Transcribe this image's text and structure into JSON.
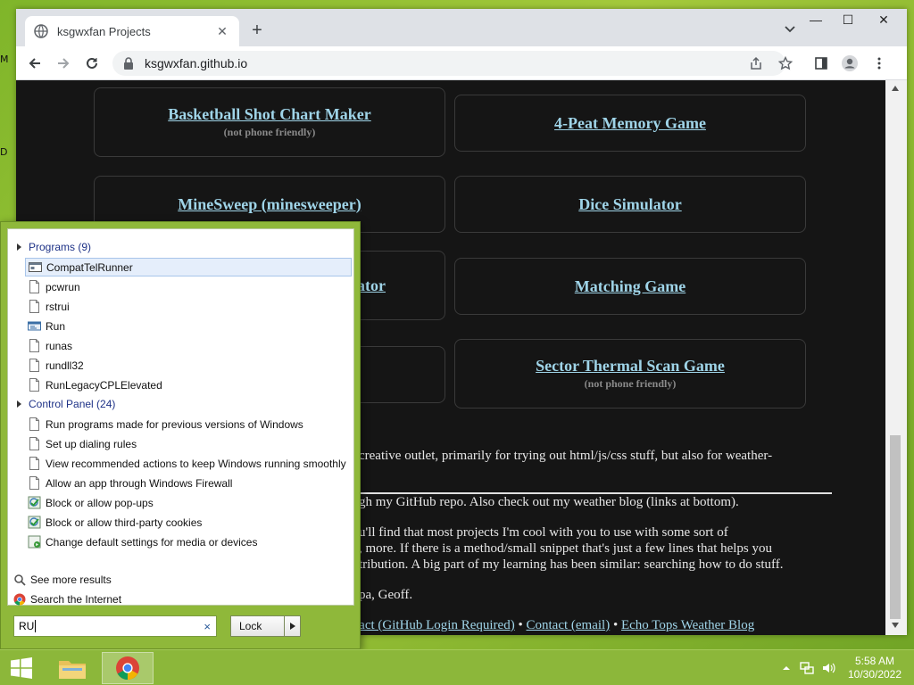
{
  "desktop": {
    "label_m": "M",
    "label_d": "D"
  },
  "browser": {
    "tab_title": "ksgwxfan Projects",
    "url": "ksgwxfan.github.io",
    "window_controls": {
      "minimize": "—",
      "maximize": "☐",
      "close": "✕"
    }
  },
  "page": {
    "cards": [
      {
        "title": "Basketball Shot Chart Maker",
        "subtitle": "(not phone friendly)"
      },
      {
        "title": "4-Peat Memory Game",
        "subtitle": ""
      },
      {
        "title": "MineSweep (minesweeper)",
        "subtitle": ""
      },
      {
        "title": "Dice Simulator",
        "subtitle": ""
      },
      {
        "title": "ator",
        "subtitle": ""
      },
      {
        "title": "Matching Game",
        "subtitle": ""
      },
      {
        "title": "Sector Thermal Scan Game",
        "subtitle": "(not phone friendly)"
      }
    ],
    "paragraphs": [
      "creative outlet, primarily for trying out html/js/css stuff, but also for weather-",
      "gh my GitHub repo. Also check out my weather blog (links at bottom).",
      "u'll find that most projects I'm cool with you to use with some sort of",
      ", more. If there is a method/small snippet that's just a few lines that helps you",
      "tribution. A big part of my learning has been similar: searching how to do stuff.",
      "pa, Geoff."
    ],
    "footer_links": {
      "contact_github": "tact (GitHub Login Required)",
      "contact_email": "Contact (email)",
      "blog": "Echo Tops Weather Blog",
      "separator": "•"
    }
  },
  "start_menu": {
    "programs_header": "Programs (9)",
    "programs": [
      {
        "label": "CompatTelRunner",
        "icon": "app-window-icon"
      },
      {
        "label": "pcwrun",
        "icon": "file-icon"
      },
      {
        "label": "rstrui",
        "icon": "file-icon"
      },
      {
        "label": "Run",
        "icon": "run-icon"
      },
      {
        "label": "runas",
        "icon": "file-icon"
      },
      {
        "label": "rundll32",
        "icon": "file-icon"
      },
      {
        "label": "RunLegacyCPLElevated",
        "icon": "file-icon"
      }
    ],
    "control_panel_header": "Control Panel (24)",
    "control_panel": [
      {
        "label": "Run programs made for previous versions of Windows",
        "icon": "file-icon"
      },
      {
        "label": "Set up dialing rules",
        "icon": "file-icon"
      },
      {
        "label": "View recommended actions to keep Windows running smoothly",
        "icon": "file-icon"
      },
      {
        "label": "Allow an app through Windows Firewall",
        "icon": "file-icon"
      },
      {
        "label": "Block or allow pop-ups",
        "icon": "internet-options-icon"
      },
      {
        "label": "Block or allow third-party cookies",
        "icon": "internet-options-icon"
      },
      {
        "label": "Change default settings for media or devices",
        "icon": "autoplay-icon"
      }
    ],
    "see_more": "See more results",
    "search_internet": "Search the Internet",
    "search_value": "RU",
    "search_clear": "×",
    "lock_label": "Lock"
  },
  "taskbar": {
    "time": "5:58 AM",
    "date": "10/30/2022"
  },
  "colors": {
    "link": "#9fd4e8",
    "page_bg": "#151515",
    "desktop_green": "#8cb73a",
    "menu_header": "#1e3287"
  }
}
